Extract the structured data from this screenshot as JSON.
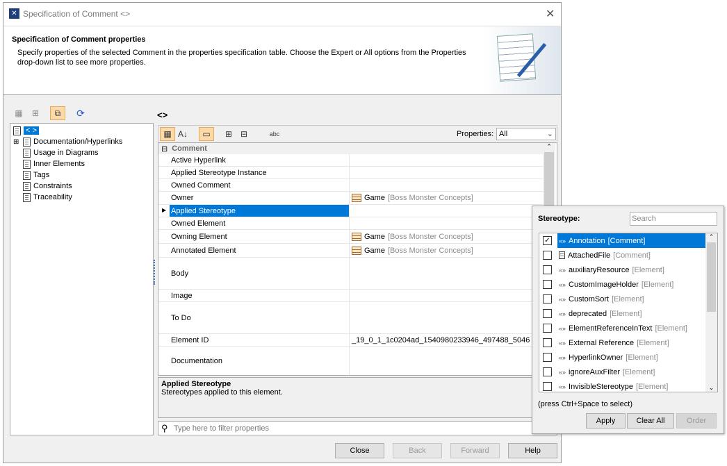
{
  "window": {
    "title": "Specification of Comment <>"
  },
  "header": {
    "title": "Specification of Comment properties",
    "description": "Specify properties of the selected Comment in the properties specification table. Choose the Expert or All options from the Properties drop-down list to see more properties."
  },
  "tree": {
    "root": "< >",
    "items": [
      "Documentation/Hyperlinks",
      "Usage in Diagrams",
      "Inner Elements",
      "Tags",
      "Constraints",
      "Traceability"
    ]
  },
  "right": {
    "title": "<>",
    "properties_label": "Properties:",
    "properties_value": "All"
  },
  "table": {
    "group": "Comment",
    "rows": [
      {
        "name": "Active Hyperlink",
        "value": "",
        "owner": ""
      },
      {
        "name": "Applied Stereotype Instance",
        "value": "",
        "owner": ""
      },
      {
        "name": "Owned Comment",
        "value": "",
        "owner": ""
      },
      {
        "name": "Owner",
        "value": "Game",
        "owner": "[Boss Monster Concepts]"
      },
      {
        "name": "Applied Stereotype",
        "value": "",
        "owner": ""
      },
      {
        "name": "Owned Element",
        "value": "",
        "owner": ""
      },
      {
        "name": "Owning Element",
        "value": "Game",
        "owner": "[Boss Monster Concepts]"
      },
      {
        "name": "Annotated Element",
        "value": "Game",
        "owner": "[Boss Monster Concepts]"
      },
      {
        "name": "Body",
        "value": "",
        "owner": ""
      },
      {
        "name": "Image",
        "value": "",
        "owner": ""
      },
      {
        "name": "To Do",
        "value": "",
        "owner": ""
      },
      {
        "name": "Element ID",
        "value": "_19_0_1_1c0204ad_1540980233946_497488_5046",
        "owner": ""
      },
      {
        "name": "Documentation",
        "value": "",
        "owner": ""
      }
    ]
  },
  "description": {
    "title": "Applied Stereotype",
    "text": "Stereotypes applied to this element."
  },
  "filter": {
    "placeholder": "Type here to filter properties"
  },
  "buttons": {
    "close": "Close",
    "back": "Back",
    "forward": "Forward",
    "help": "Help"
  },
  "popup": {
    "label": "Stereotype:",
    "search_placeholder": "Search",
    "hint": "(press Ctrl+Space to select)",
    "apply": "Apply",
    "clear_all": "Clear All",
    "order": "Order",
    "items": [
      {
        "name": "Annotation",
        "scope": "[Comment]",
        "checked": true
      },
      {
        "name": "AttachedFile",
        "scope": "[Comment]",
        "checked": false
      },
      {
        "name": "auxiliaryResource",
        "scope": "[Element]",
        "checked": false
      },
      {
        "name": "CustomImageHolder",
        "scope": "[Element]",
        "checked": false
      },
      {
        "name": "CustomSort",
        "scope": "[Element]",
        "checked": false
      },
      {
        "name": "deprecated",
        "scope": "[Element]",
        "checked": false
      },
      {
        "name": "ElementReferenceInText",
        "scope": "[Element]",
        "checked": false
      },
      {
        "name": "External Reference",
        "scope": "[Element]",
        "checked": false
      },
      {
        "name": "HyperlinkOwner",
        "scope": "[Element]",
        "checked": false
      },
      {
        "name": "ignoreAuxFilter",
        "scope": "[Element]",
        "checked": false
      },
      {
        "name": "InvisibleStereotype",
        "scope": "[Element]",
        "checked": false
      }
    ]
  }
}
